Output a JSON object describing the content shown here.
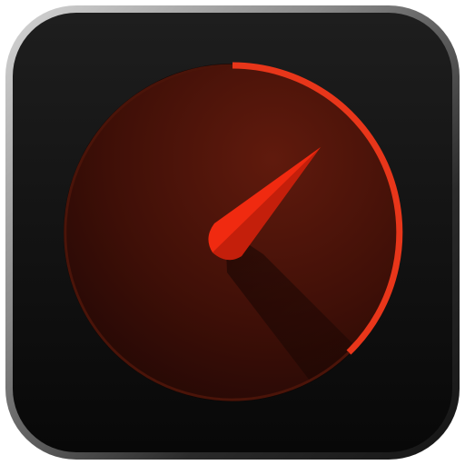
{
  "icon": {
    "name": "speedometer-app-icon",
    "depicts": "gauge-icon",
    "gauge_level": 0.125
  },
  "colors": {
    "bezel_light": "#c9c9c9",
    "bezel_dark": "#2b2b2b",
    "face_bg": "#141414",
    "dial_outer": "#3a0f08",
    "dial_inner": "#5a170c",
    "rim_accent": "#e8361a",
    "needle": "#f02a10",
    "needle_shade": "#b51c0a"
  }
}
